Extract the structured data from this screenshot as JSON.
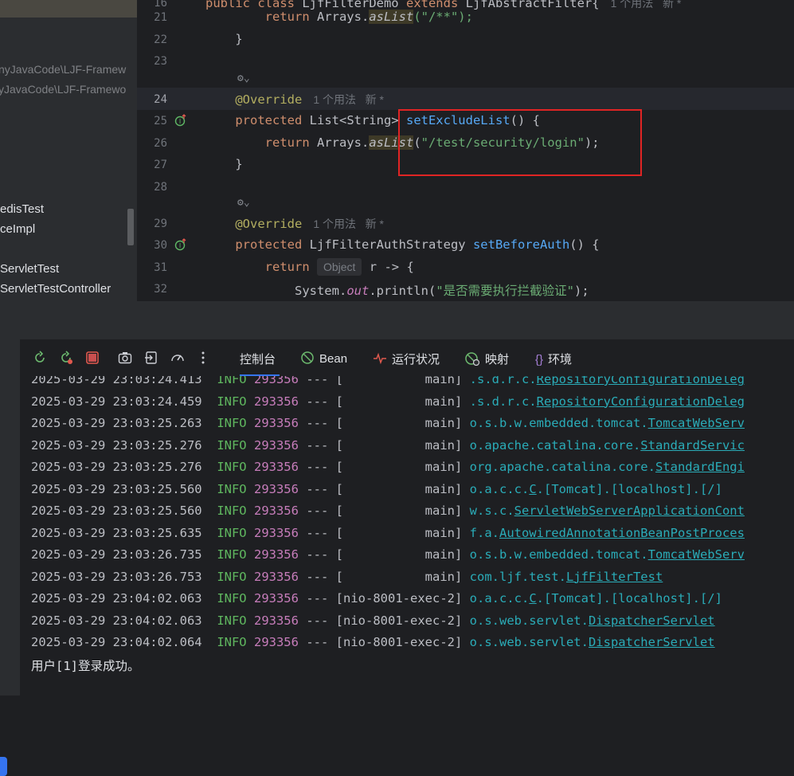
{
  "project_tree": {
    "paths": [
      "nyJavaCode\\LJF-Framew",
      "yJavaCode\\LJF-Framewo"
    ],
    "items": [
      "edisTest",
      "ceImpl",
      "ServletTest",
      "ServletTestController"
    ]
  },
  "editor": {
    "lines": [
      {
        "num": "16",
        "segments": [
          {
            "t": "public class ",
            "c": "kw"
          },
          {
            "t": "LjfFilterDemo ",
            "c": ""
          },
          {
            "t": "extends ",
            "c": "kw"
          },
          {
            "t": "LjfAbstractFilter{",
            "c": ""
          }
        ],
        "hint": "1 个用法   新 *"
      },
      {
        "num": "21",
        "segments": [
          {
            "t": "        return ",
            "c": "kw"
          },
          {
            "t": "Arrays.",
            "c": ""
          },
          {
            "t": "asList",
            "c": "ital asl"
          },
          {
            "t": "(\"/**\");",
            "c": "str"
          }
        ]
      },
      {
        "num": "22",
        "segments": [
          {
            "t": "    }",
            "c": ""
          }
        ]
      },
      {
        "num": "23",
        "segments": []
      },
      {
        "num": "24",
        "segments": [
          {
            "t": "    @Override",
            "c": "ann"
          }
        ],
        "hint": "1 个用法   新 *"
      },
      {
        "num": "25",
        "segments": [
          {
            "t": "    protected ",
            "c": "kw"
          },
          {
            "t": "List<String> ",
            "c": ""
          },
          {
            "t": "setExcludeList",
            "c": "fn"
          },
          {
            "t": "() {",
            "c": ""
          }
        ]
      },
      {
        "num": "26",
        "segments": [
          {
            "t": "        return ",
            "c": "kw"
          },
          {
            "t": "Arrays.",
            "c": ""
          },
          {
            "t": "asList",
            "c": "ital asl"
          },
          {
            "t": "(",
            "c": ""
          },
          {
            "t": "\"/test/security/login\"",
            "c": "str"
          },
          {
            "t": ");",
            "c": ""
          }
        ]
      },
      {
        "num": "27",
        "segments": [
          {
            "t": "    }",
            "c": ""
          }
        ]
      },
      {
        "num": "28",
        "segments": []
      },
      {
        "num": "29",
        "segments": [
          {
            "t": "    @Override",
            "c": "ann"
          }
        ],
        "hint": "1 个用法   新 *"
      },
      {
        "num": "30",
        "segments": [
          {
            "t": "    protected ",
            "c": "kw"
          },
          {
            "t": "LjfFilterAuthStrategy ",
            "c": ""
          },
          {
            "t": "setBeforeAuth",
            "c": "fn"
          },
          {
            "t": "() {",
            "c": ""
          }
        ]
      },
      {
        "num": "31",
        "segments": [
          {
            "t": "        return ",
            "c": "kw"
          }
        ],
        "inlay": "Object",
        "after_inlay": " r -> {"
      },
      {
        "num": "32",
        "segments": [
          {
            "t": "            System.",
            "c": ""
          },
          {
            "t": "out",
            "c": "st"
          },
          {
            "t": ".println(",
            "c": ""
          },
          {
            "t": "\"是否需要执行拦截验证\"",
            "c": "str"
          },
          {
            "t": ");",
            "c": ""
          }
        ]
      }
    ]
  },
  "console_toolbar": {
    "icons": [
      "rerun-icon",
      "rerun-failed-icon",
      "stop-icon",
      "screenshot-icon",
      "export-icon",
      "dashboard-icon",
      "more-options-icon"
    ],
    "tabs": [
      {
        "label": "控制台",
        "icon": ""
      },
      {
        "label": "Bean",
        "icon": "bean-icon"
      },
      {
        "label": "运行状况",
        "icon": "health-icon"
      },
      {
        "label": "映射",
        "icon": "mapping-icon"
      },
      {
        "label": "环境",
        "icon": "environment-icon"
      }
    ]
  },
  "console": {
    "rows": [
      {
        "ts": "2025-03-29 23:03:24.413",
        "level": "INFO",
        "pid": "293356",
        "sep": "---",
        "thread": "[           main]",
        "pkg": ".s.d.r.c.",
        "cls": "RepositoryConfigurationDeleg"
      },
      {
        "ts": "2025-03-29 23:03:24.459",
        "level": "INFO",
        "pid": "293356",
        "sep": "---",
        "thread": "[           main]",
        "pkg": ".s.d.r.c.",
        "cls": "RepositoryConfigurationDeleg"
      },
      {
        "ts": "2025-03-29 23:03:25.263",
        "level": "INFO",
        "pid": "293356",
        "sep": "---",
        "thread": "[           main]",
        "pkg": "o.s.b.w.embedded.tomcat.",
        "cls": "TomcatWebServ"
      },
      {
        "ts": "2025-03-29 23:03:25.276",
        "level": "INFO",
        "pid": "293356",
        "sep": "---",
        "thread": "[           main]",
        "pkg": "o.apache.catalina.core.",
        "cls": "StandardServic"
      },
      {
        "ts": "2025-03-29 23:03:25.276",
        "level": "INFO",
        "pid": "293356",
        "sep": "---",
        "thread": "[           main]",
        "pkg": "org.apache.catalina.core.",
        "cls": "StandardEngi"
      },
      {
        "ts": "2025-03-29 23:03:25.560",
        "level": "INFO",
        "pid": "293356",
        "sep": "---",
        "thread": "[           main]",
        "pkg": "o.a.c.c.",
        "cls": "C",
        "tail": ".[Tomcat].[localhost].[/]"
      },
      {
        "ts": "2025-03-29 23:03:25.560",
        "level": "INFO",
        "pid": "293356",
        "sep": "---",
        "thread": "[           main]",
        "pkg": "w.s.c.",
        "cls": "ServletWebServerApplicationCont"
      },
      {
        "ts": "2025-03-29 23:03:25.635",
        "level": "INFO",
        "pid": "293356",
        "sep": "---",
        "thread": "[           main]",
        "pkg": "f.a.",
        "cls": "AutowiredAnnotationBeanPostProces"
      },
      {
        "ts": "2025-03-29 23:03:26.735",
        "level": "INFO",
        "pid": "293356",
        "sep": "---",
        "thread": "[           main]",
        "pkg": "o.s.b.w.embedded.tomcat.",
        "cls": "TomcatWebServ"
      },
      {
        "ts": "2025-03-29 23:03:26.753",
        "level": "INFO",
        "pid": "293356",
        "sep": "---",
        "thread": "[           main]",
        "pkg": "com.ljf.test.",
        "cls": "LjfFilterTest"
      },
      {
        "ts": "2025-03-29 23:04:02.063",
        "level": "INFO",
        "pid": "293356",
        "sep": "---",
        "thread": "[nio-8001-exec-2]",
        "pkg": "o.a.c.c.",
        "cls": "C",
        "tail": ".[Tomcat].[localhost].[/]"
      },
      {
        "ts": "2025-03-29 23:04:02.063",
        "level": "INFO",
        "pid": "293356",
        "sep": "---",
        "thread": "[nio-8001-exec-2]",
        "pkg": "o.s.web.servlet.",
        "cls": "DispatcherServlet"
      },
      {
        "ts": "2025-03-29 23:04:02.064",
        "level": "INFO",
        "pid": "293356",
        "sep": "---",
        "thread": "[nio-8001-exec-2]",
        "pkg": "o.s.web.servlet.",
        "cls": "DispatcherServlet"
      }
    ],
    "final_message": "用户[1]登录成功。"
  },
  "colors": {
    "editor_bg": "#1e1f22",
    "panel_bg": "#2b2d30",
    "highlight_box": "#e02424",
    "accent": "#3574f0"
  }
}
